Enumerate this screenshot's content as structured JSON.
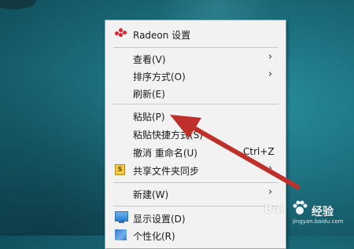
{
  "context_menu": {
    "radeon": {
      "label": "Radeon 设置",
      "icon": "radeon-icon"
    },
    "view": {
      "label": "查看(V)"
    },
    "sort": {
      "label": "排序方式(O)"
    },
    "refresh": {
      "label": "刷新(E)"
    },
    "paste": {
      "label": "粘贴(P)"
    },
    "paste_shortcut": {
      "label": "粘贴快捷方式(S)"
    },
    "undo_rename": {
      "label": "撤消 重命名(U)",
      "shortcut": "Ctrl+Z"
    },
    "share_sync": {
      "label": "共享文件夹同步",
      "icon": "share-sync-icon",
      "icon_text": "S"
    },
    "new": {
      "label": "新建(W)"
    },
    "display": {
      "label": "显示设置(D)",
      "icon": "display-icon"
    },
    "personalize": {
      "label": "个性化(R)",
      "icon": "personalize-icon"
    },
    "submenu_glyph": "›"
  },
  "annotation": {
    "arrow_color": "#c0302a",
    "points_to": "paste"
  },
  "watermark": {
    "brand_left": "Bai",
    "brand_right": "经验",
    "url": "jingyan.baidu.com"
  },
  "colors": {
    "desktop": "#1f7686",
    "menu_bg": "#f2f2f2",
    "text": "#1a1a1a",
    "separator": "#c8c8c8",
    "radeon_red": "#d8262b"
  }
}
